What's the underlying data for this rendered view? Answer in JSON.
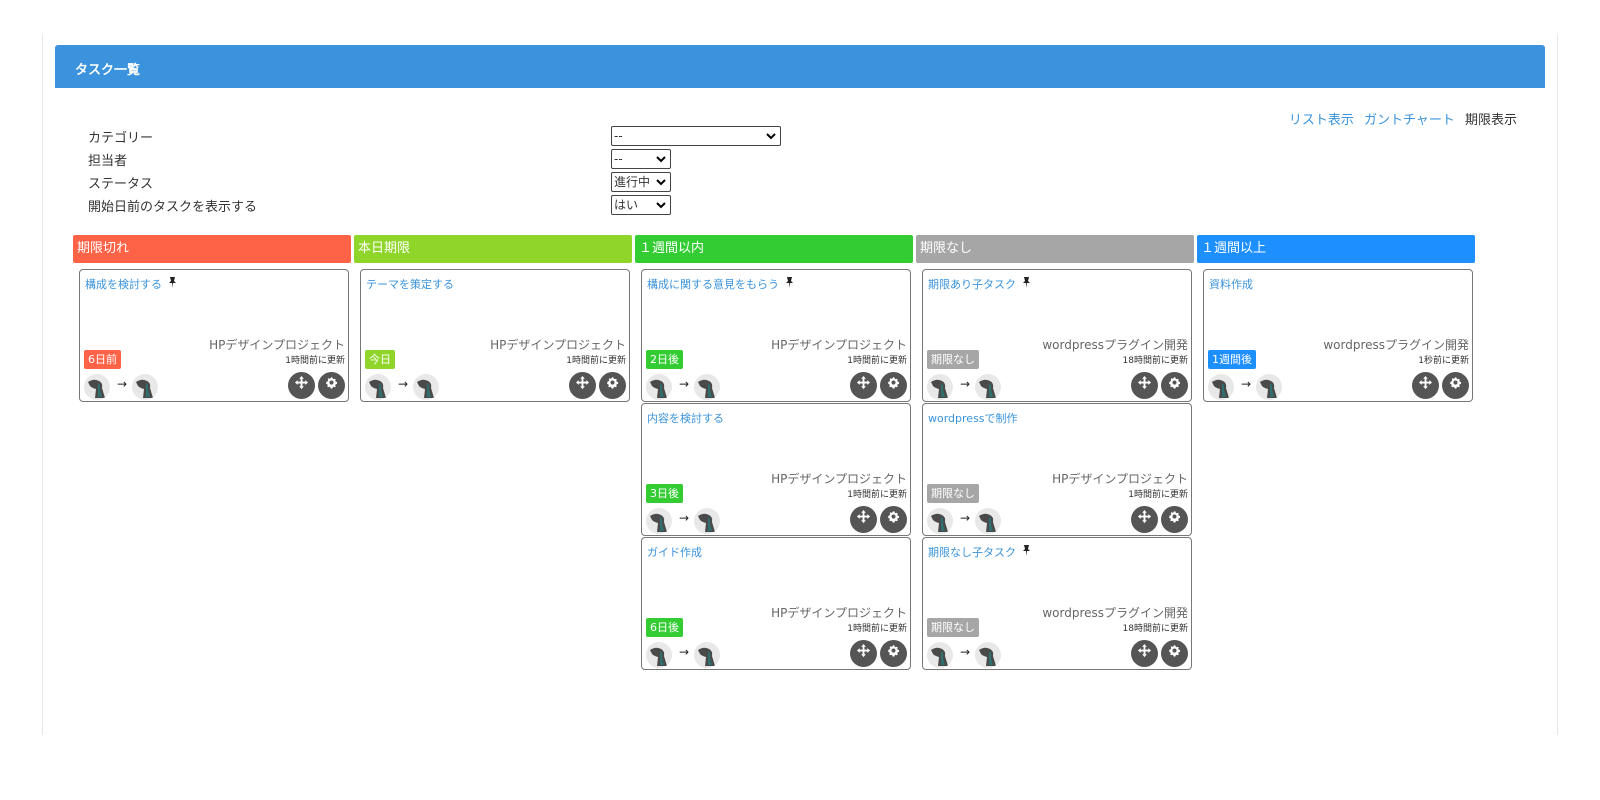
{
  "header": {
    "title": "タスク一覧"
  },
  "view_links": {
    "list": "リスト表示",
    "gantt": "ガントチャート",
    "deadline": "期限表示"
  },
  "filters": [
    {
      "label": "カテゴリー",
      "value": "--"
    },
    {
      "label": "担当者",
      "value": "--"
    },
    {
      "label": "ステータス",
      "value": "進行中"
    },
    {
      "label": "開始日前のタスクを表示する",
      "value": "はい"
    }
  ],
  "columns": [
    {
      "title": "期限切れ",
      "color": "#fe6347"
    },
    {
      "title": "本日期限",
      "color": "#8fd52a"
    },
    {
      "title": "１週間以内",
      "color": "#33cc33"
    },
    {
      "title": "期限なし",
      "color": "#a6a6a6"
    },
    {
      "title": "１週間以上",
      "color": "#1e8fff"
    }
  ],
  "cards": [
    {
      "title": "構成を検討する",
      "pinned": true,
      "project": "HPデザインプロジェクト",
      "updated": "1時間前に更新",
      "badge": "6日前",
      "badge_color": "#fe6347"
    },
    {
      "title": "テーマを策定する",
      "pinned": false,
      "project": "HPデザインプロジェクト",
      "updated": "1時間前に更新",
      "badge": "今日",
      "badge_color": "#8fd52a"
    },
    {
      "title": "構成に関する意見をもらう",
      "pinned": true,
      "project": "HPデザインプロジェクト",
      "updated": "1時間前に更新",
      "badge": "2日後",
      "badge_color": "#33cc33"
    },
    {
      "title": "内容を検討する",
      "pinned": false,
      "project": "HPデザインプロジェクト",
      "updated": "1時間前に更新",
      "badge": "3日後",
      "badge_color": "#33cc33"
    },
    {
      "title": "ガイド作成",
      "pinned": false,
      "project": "HPデザインプロジェクト",
      "updated": "1時間前に更新",
      "badge": "6日後",
      "badge_color": "#33cc33"
    },
    {
      "title": "期限あり子タスク",
      "pinned": true,
      "project": "wordpressプラグイン開発",
      "updated": "18時間前に更新",
      "badge": "期限なし",
      "badge_color": "#a6a6a6"
    },
    {
      "title": "wordpressで制作",
      "pinned": false,
      "project": "HPデザインプロジェクト",
      "updated": "1時間前に更新",
      "badge": "期限なし",
      "badge_color": "#a6a6a6"
    },
    {
      "title": "期限なし子タスク",
      "pinned": true,
      "project": "wordpressプラグイン開発",
      "updated": "18時間前に更新",
      "badge": "期限なし",
      "badge_color": "#a6a6a6"
    },
    {
      "title": "資料作成",
      "pinned": false,
      "project": "wordpressプラグイン開発",
      "updated": "1秒前に更新",
      "badge": "1週間後",
      "badge_color": "#1e8fff"
    }
  ],
  "icons": {
    "pin": "pin-icon",
    "move": "move-icon",
    "settings": "gear-icon",
    "arrow": "arrow-right-icon",
    "avatar": "avatar-icon"
  },
  "glyphs": {
    "arrow": "→",
    "chevron": "⌄",
    "pin": "▾"
  }
}
